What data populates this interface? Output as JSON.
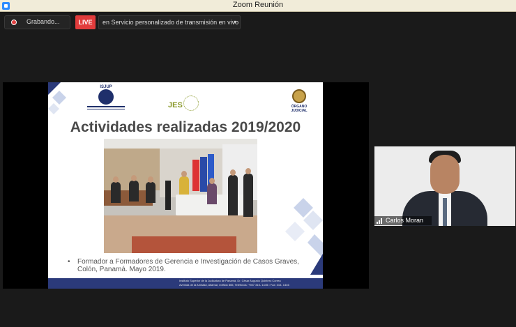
{
  "window": {
    "title": "Zoom Reunión",
    "app_icon": "zoom-icon"
  },
  "toolbar": {
    "recording_label": "Grabando...",
    "recording_icon": "record-icon",
    "live_badge": "LIVE",
    "live_color": "#e23c3c",
    "stream_label": "en Servicio personalizado de transmisión en vivo",
    "stream_caret": "▾"
  },
  "slide": {
    "logos": {
      "left_name": "ISJUP",
      "center_name": "JES",
      "right_name": "ÓRGANO JUDICIAL"
    },
    "title": "Actividades realizadas 2019/2020",
    "bullet_marker": "•",
    "bullet_text": "Formador a Formadores de Gerencia e Investigación de Casos Graves, Colón, Panamá. Mayo 2019.",
    "footer_line1": "Instituto Superior de la Judicatura de Panamá, Dr. César Augusto Quintero Correa",
    "footer_line2": "Avenida de la Amistad, Altamar, edificio 865, Teléfonos: +507 315- 1445 • Fax: 315- 1446",
    "accent_color": "#2b3a7a"
  },
  "participant": {
    "name": "Carlos Moran",
    "signal_icon": "signal-bars-icon"
  }
}
